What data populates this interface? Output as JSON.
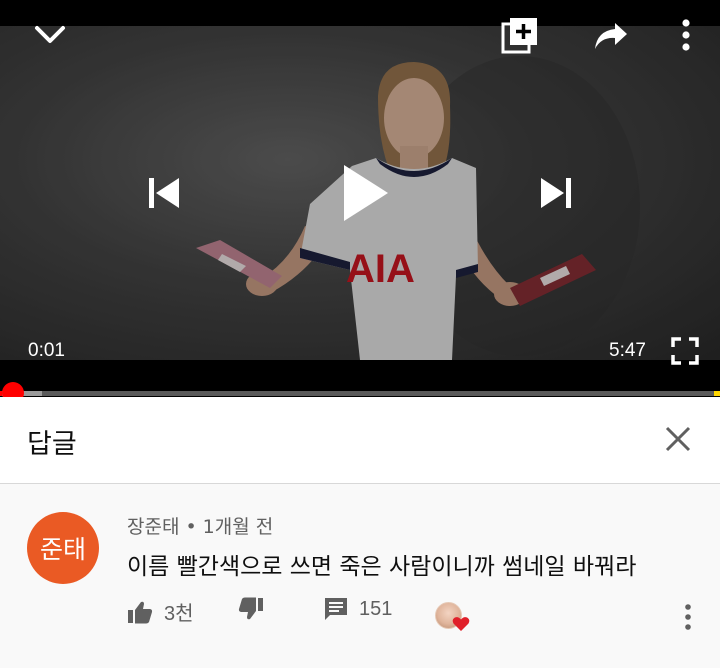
{
  "player": {
    "current_time": "0:01",
    "duration": "5:47",
    "progress_fraction": 0.003,
    "buffered_fraction": 0.058,
    "jersey_text": "AIA"
  },
  "replies_header": {
    "title": "답글"
  },
  "comment": {
    "avatar_text": "준태",
    "author": "장준태",
    "separator": "•",
    "time_ago": "1개월 전",
    "text": "이름 빨간색으로 쓰면 죽은 사람이니까 썸네일 바꿔라",
    "like_count": "3천",
    "reply_count": "151"
  },
  "colors": {
    "accent_red": "#ff0000",
    "avatar_orange": "#ea5a24",
    "heart_red": "#e0202a"
  },
  "icons": {
    "minimize": "chevron-down-icon",
    "add_to_playlist": "playlist-add-icon",
    "share": "share-icon",
    "more": "more-vert-icon",
    "previous": "skip-previous-icon",
    "play": "play-icon",
    "next": "skip-next-icon",
    "fullscreen": "fullscreen-icon",
    "close": "close-icon",
    "like": "thumb-up-icon",
    "dislike": "thumb-down-icon",
    "reply": "comment-icon",
    "creator_heart": "heart-icon"
  }
}
